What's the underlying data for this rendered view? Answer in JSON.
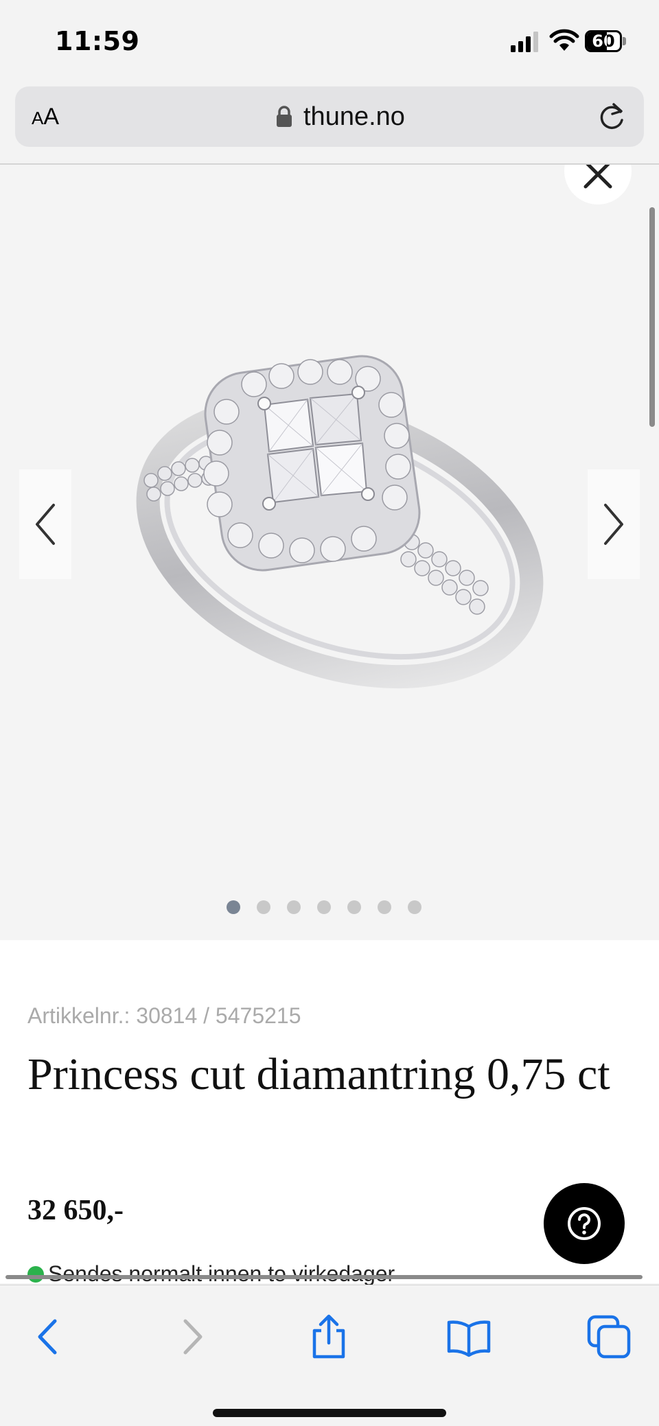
{
  "status_bar": {
    "time": "11:59",
    "battery_level": "60",
    "battery_fraction": 0.6
  },
  "browser": {
    "text_size_label_small": "A",
    "text_size_label_large": "A",
    "url": "thune.no"
  },
  "gallery": {
    "image_count": 7,
    "active_index": 0,
    "image_alt": "Princess cut diamantring"
  },
  "product": {
    "sku": "Artikkelnr.: 30814 / 5475215",
    "title": "Princess cut diamantring 0,75 ct",
    "price": "32 650,-",
    "shipping": "Sendes normalt innen to virkedager",
    "shipping_status_color": "#2bb24c"
  },
  "help": {
    "icon": "question-icon"
  },
  "toolbar": {
    "icons": [
      "back-icon",
      "forward-icon",
      "share-icon",
      "bookmarks-icon",
      "tabs-icon"
    ],
    "accent_color": "#1a73e8"
  }
}
